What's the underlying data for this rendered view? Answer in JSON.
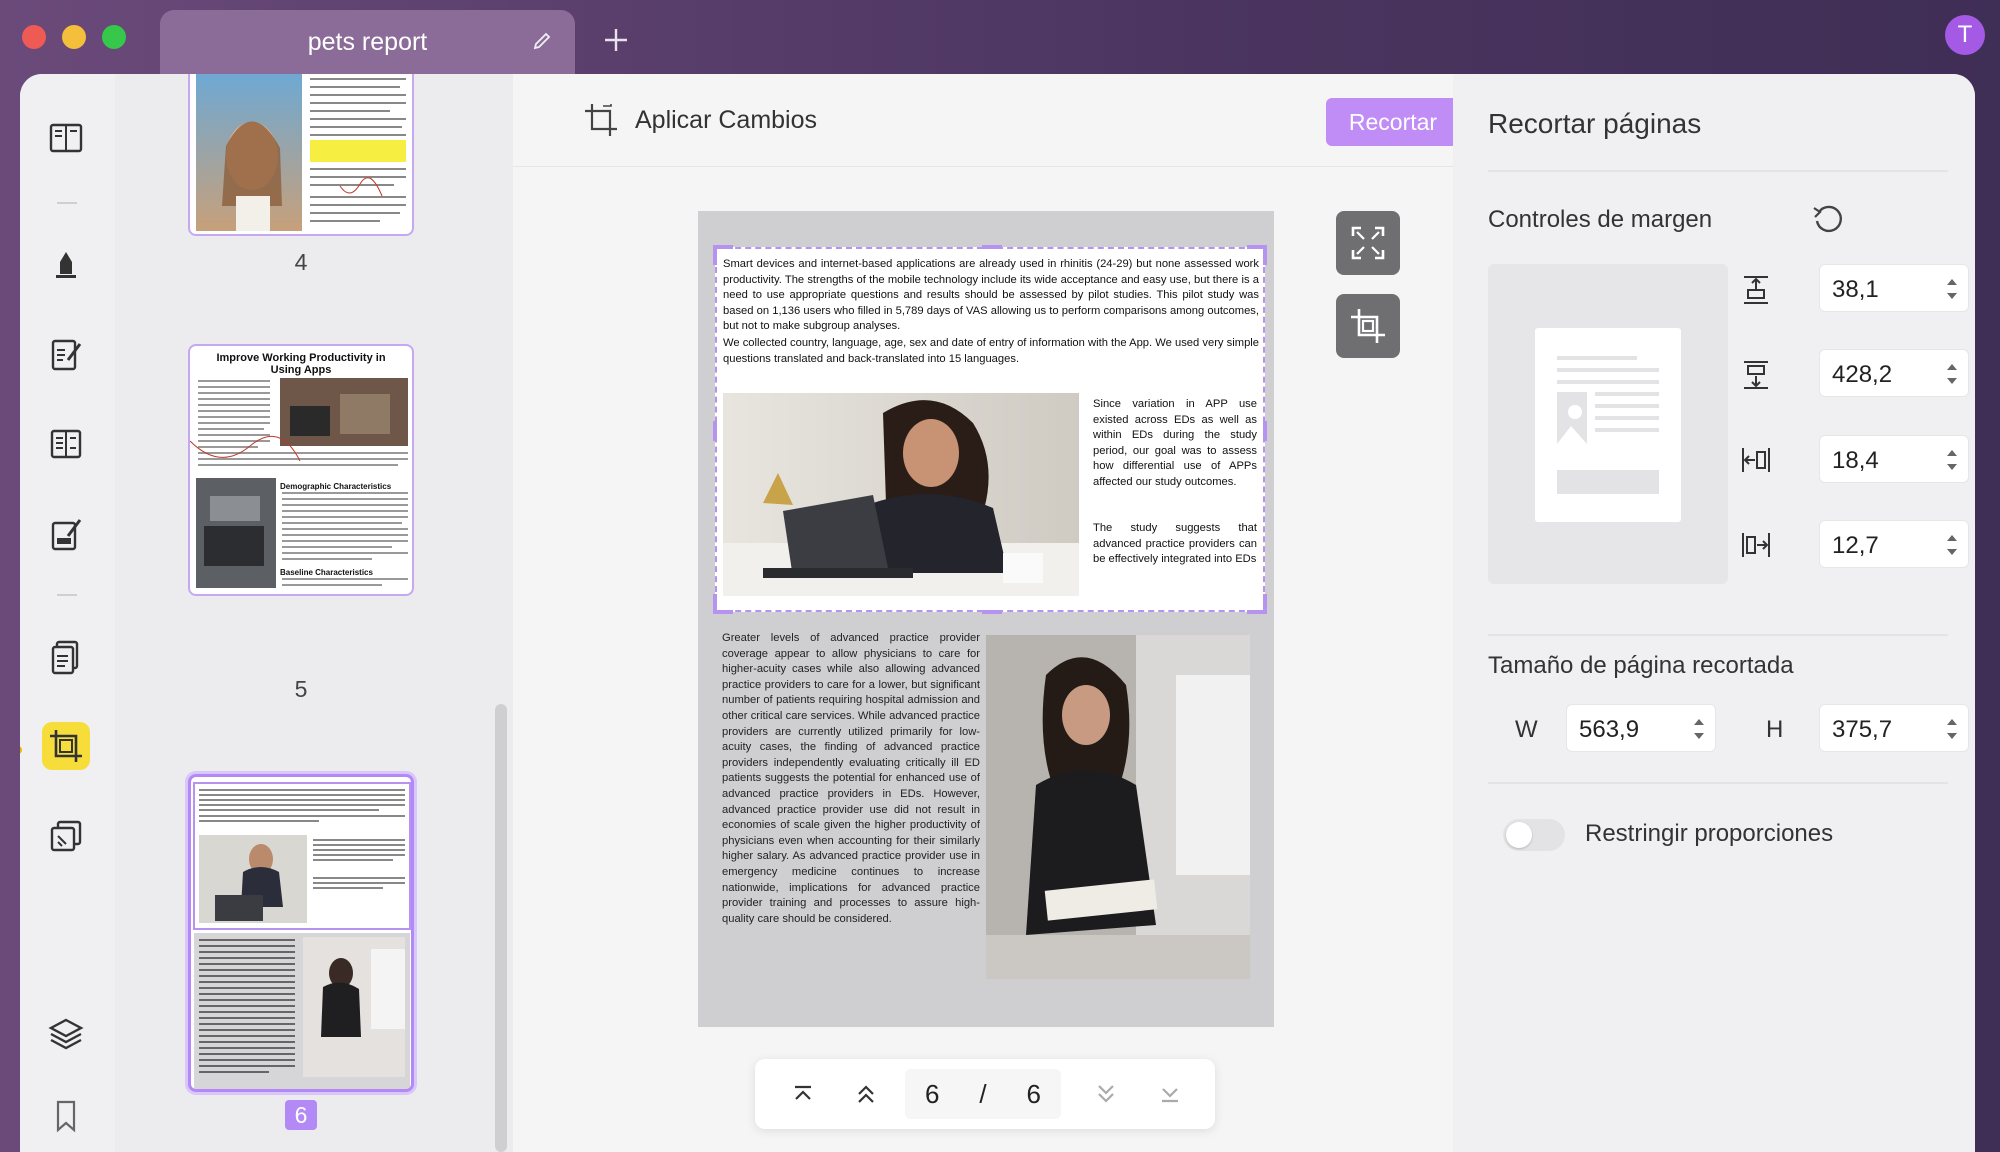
{
  "titlebar": {
    "tab_title": "pets report",
    "avatar_letter": "T"
  },
  "toolbar": {
    "apply_label": "Aplicar Cambios",
    "crop_button": "Recortar"
  },
  "thumbnails": {
    "pages": [
      {
        "label": "4",
        "heading": ""
      },
      {
        "label": "5",
        "heading": "Improve Working Productivity in Using Apps",
        "sub1": "Demographic Characteristics",
        "sub2": "Baseline Characteristics"
      },
      {
        "label": "6",
        "heading": ""
      }
    ]
  },
  "document": {
    "para1": "Smart devices and internet-based applications are already used in rhinitis (24-29) but none assessed work productivity. The strengths of the mobile technology include its wide acceptance and easy use, but there is a need to use appropriate questions and results should be assessed by pilot studies. This pilot study was based on 1,136 users who filled in 5,789 days of VAS allowing us to perform comparisons among outcomes, but not to make subgroup analyses.",
    "para2": "We collected country, language, age, sex and date of entry of information with the App. We used very simple questions translated and back-translated into 15 languages.",
    "side1": "Since variation in APP use existed across EDs as well as within EDs during the study period, our goal was to assess how differential use of APPs affected our study outcomes.",
    "side2": "The study suggests that advanced practice providers can be effectively integrated into EDs",
    "lower": "Greater levels of advanced practice provider coverage appear to allow physicians to care for higher-acuity cases while also allowing advanced practice providers to care for a lower, but significant number of patients requiring hospital admission and other critical care services. While advanced practice providers are currently utilized primarily for low-acuity cases, the finding of advanced practice providers independently evaluating critically ill ED patients suggests the potential for enhanced use of advanced practice providers in EDs. However, advanced practice provider use did not result in economies of scale given the higher productivity of physicians even when accounting for their similarly higher salary. As advanced practice provider use in emergency medicine continues to increase nationwide, implications for advanced practice provider training and processes to assure high-quality care should be considered."
  },
  "pager": {
    "current": "6",
    "separator": "/",
    "total": "6"
  },
  "panel": {
    "title": "Recortar páginas",
    "margins_title": "Controles de margen",
    "margin_top": "38,1",
    "margin_bottom": "428,2",
    "margin_left": "18,4",
    "margin_right": "12,7",
    "size_title": "Tamaño de página recortada",
    "w_label": "W",
    "w_value": "563,9",
    "h_label": "H",
    "h_value": "375,7",
    "constrain_label": "Restringir proporciones",
    "constrain_on": false
  },
  "colors": {
    "accent": "#c08cf6",
    "active_tool": "#f6dd3a"
  }
}
